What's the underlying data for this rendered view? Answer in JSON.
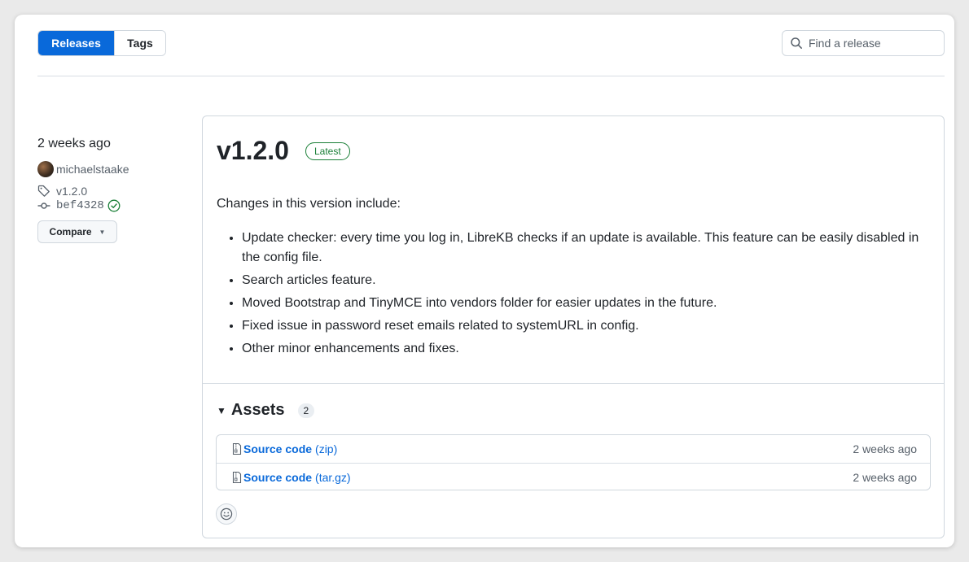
{
  "tabs": {
    "releases_label": "Releases",
    "tags_label": "Tags"
  },
  "search": {
    "placeholder": "Find a release"
  },
  "sidebar": {
    "date": "2 weeks ago",
    "author": "michaelstaake",
    "tag": "v1.2.0",
    "commit": "bef4328",
    "compare_label": "Compare"
  },
  "release": {
    "version": "v1.2.0",
    "badge": "Latest",
    "intro": "Changes in this version include:",
    "changes": [
      "Update checker: every time you log in, LibreKB checks if an update is available. This feature can be easily disabled in the config file.",
      "Search articles feature.",
      "Moved Bootstrap and TinyMCE into vendors folder for easier updates in the future.",
      "Fixed issue in password reset emails related to systemURL in config.",
      "Other minor enhancements and fixes."
    ]
  },
  "assets": {
    "title": "Assets",
    "count": "2",
    "items": [
      {
        "name": "Source code",
        "ext": "(zip)",
        "date": "2 weeks ago"
      },
      {
        "name": "Source code",
        "ext": "(tar.gz)",
        "date": "2 weeks ago"
      }
    ]
  },
  "colors": {
    "accent": "#0969da",
    "success": "#1a7f37",
    "border": "#d0d7de",
    "muted": "#57606a"
  },
  "icons": [
    "search-icon",
    "tag-icon",
    "commit-icon",
    "check-circle-icon",
    "zip-file-icon",
    "smiley-icon",
    "triangle-down-icon"
  ]
}
